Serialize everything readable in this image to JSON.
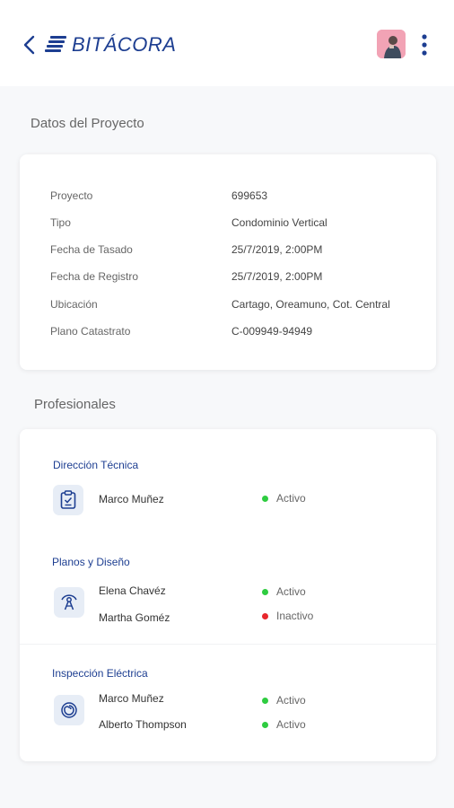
{
  "header": {
    "logo_text": "BITÁCORA",
    "icons": {
      "back": "chevron-left-icon",
      "menu": "more-vertical-icon"
    }
  },
  "project": {
    "section_title": "Datos del Proyecto",
    "fields": [
      {
        "label": "Proyecto",
        "value": "699653"
      },
      {
        "label": "Tipo",
        "value": "Condominio Vertical"
      },
      {
        "label": "Fecha de Tasado",
        "value": "25/7/2019, 2:00PM"
      },
      {
        "label": "Fecha de Registro",
        "value": "25/7/2019, 2:00PM"
      },
      {
        "label": "Ubicación",
        "value": "Cartago, Oreamuno, Cot. Central"
      },
      {
        "label": "Plano Catastrato",
        "value": "C-009949-94949"
      }
    ]
  },
  "professionals": {
    "section_title": "Profesionales",
    "groups": [
      {
        "title": "Dirección Técnica",
        "icon": "clipboard-icon",
        "people": [
          {
            "name": "Marco Muñez",
            "status": "Activo"
          }
        ]
      },
      {
        "title": "Planos y Diseño",
        "icon": "compass-icon",
        "people": [
          {
            "name": "Elena Chavéz",
            "status": "Activo"
          },
          {
            "name": "Martha Goméz",
            "status": "Inactivo"
          }
        ]
      },
      {
        "title": "Inspección Eléctrica",
        "icon": "electric-spiral-icon",
        "people": [
          {
            "name": "Marco Muñez",
            "status": "Activo"
          },
          {
            "name": "Alberto Thompson",
            "status": "Activo"
          }
        ]
      }
    ]
  },
  "colors": {
    "brand": "#1d3e91",
    "active": "#2ecc40",
    "inactive": "#e8262c"
  }
}
